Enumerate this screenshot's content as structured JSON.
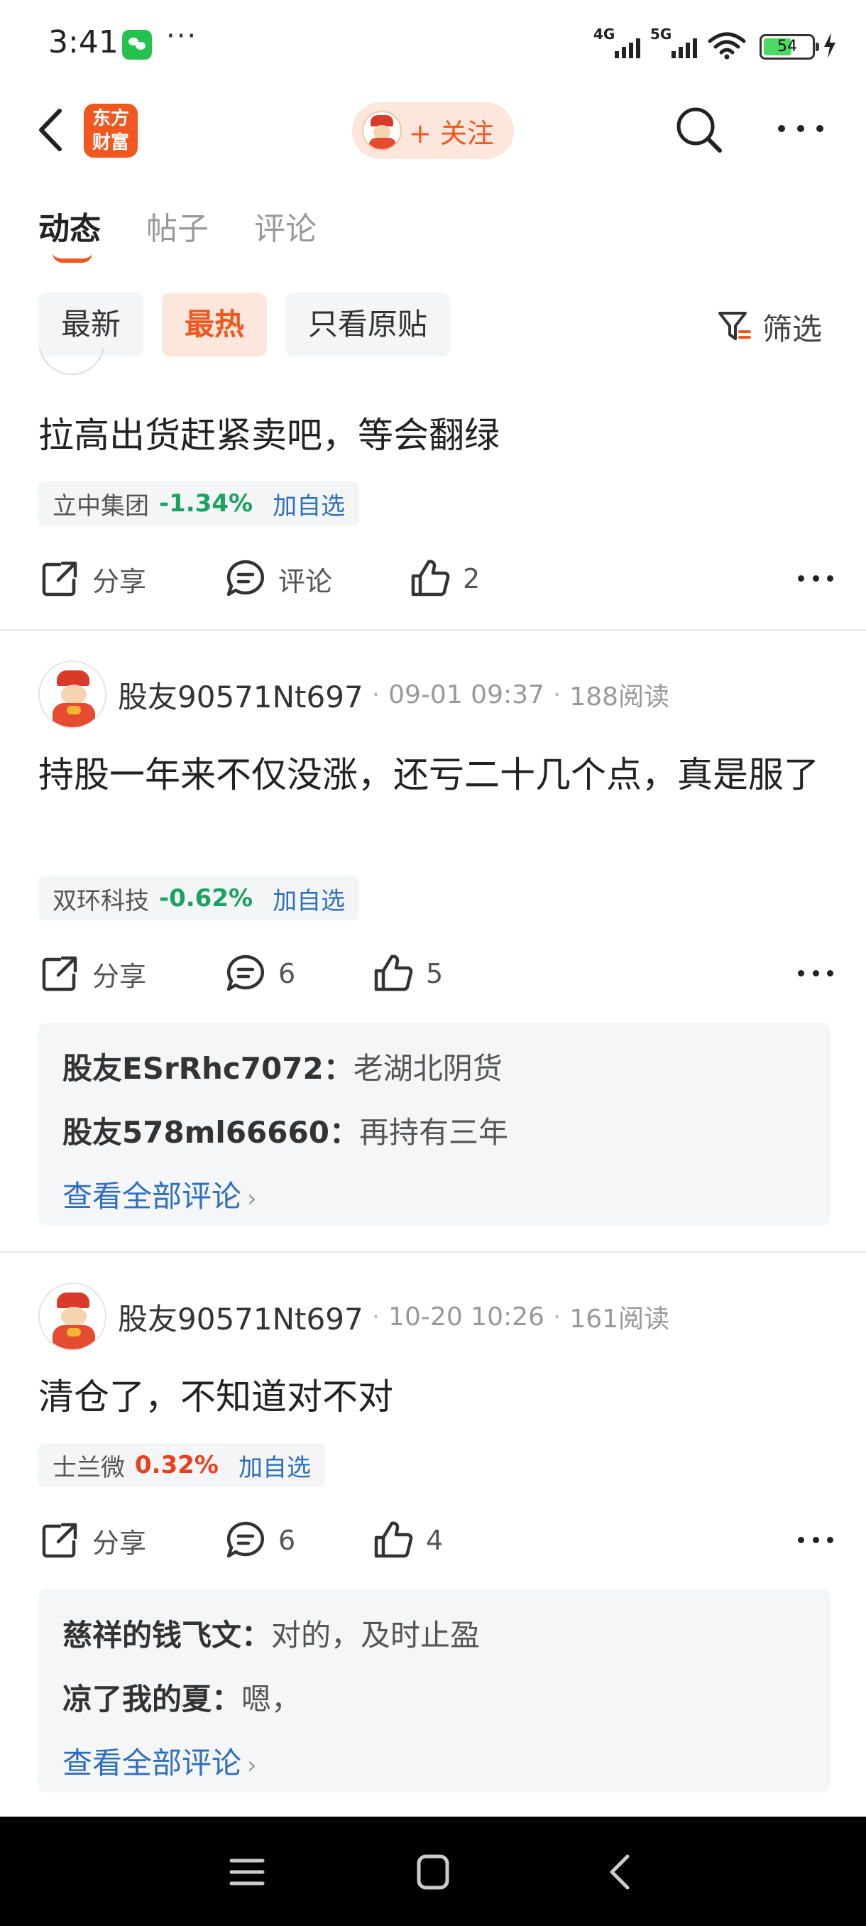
{
  "status_bar": {
    "time": "3:41",
    "more": "···",
    "signal_1": "4G",
    "signal_2": "5G",
    "battery": "54"
  },
  "header": {
    "logo_text_line1": "东方",
    "logo_text_line2": "财富",
    "follow_label": "+ 关注"
  },
  "tabs": [
    {
      "label": "动态",
      "active": true
    },
    {
      "label": "帖子",
      "active": false
    },
    {
      "label": "评论",
      "active": false
    }
  ],
  "filters": {
    "chips": [
      {
        "label": "最新",
        "active": false
      },
      {
        "label": "最热",
        "active": true
      },
      {
        "label": "只看原贴",
        "active": false
      }
    ],
    "filter_label": "筛选"
  },
  "posts": [
    {
      "text": "拉高出货赶紧卖吧，等会翻绿",
      "stock": {
        "name": "立中集团",
        "change": "-1.34%",
        "direction": "down",
        "add_label": "加自选"
      },
      "actions": {
        "share": "分享",
        "comment": "评论",
        "likes": "2"
      }
    },
    {
      "user": "股友90571Nt697",
      "date": "09-01 09:37",
      "reads": "188阅读",
      "text": "持股一年来不仅没涨，还亏二十几个点，真是服了",
      "stock": {
        "name": "双环科技",
        "change": "-0.62%",
        "direction": "down",
        "add_label": "加自选"
      },
      "actions": {
        "share": "分享",
        "comment": "6",
        "likes": "5"
      },
      "comments": [
        {
          "who": "股友ESrRhc7072",
          "sep": "：",
          "text": "老湖北阴货"
        },
        {
          "who": "股友578ml66660",
          "sep": "：",
          "text": "再持有三年"
        }
      ],
      "view_all": "查看全部评论"
    },
    {
      "user": "股友90571Nt697",
      "date": "10-20 10:26",
      "reads": "161阅读",
      "text": "清仓了，不知道对不对",
      "stock": {
        "name": "士兰微",
        "change": "0.32%",
        "direction": "up",
        "add_label": "加自选"
      },
      "actions": {
        "share": "分享",
        "comment": "6",
        "likes": "4"
      },
      "comments": [
        {
          "who": "慈祥的钱飞文",
          "sep": "：",
          "text": "对的，及时止盈"
        },
        {
          "who": "凉了我的夏",
          "sep": "：",
          "text": "嗯，"
        }
      ],
      "view_all": "查看全部评论"
    }
  ],
  "colors": {
    "accent": "#f0581f",
    "down": "#1aa260",
    "up": "#e8401c",
    "link": "#2f6fbf"
  },
  "icons": [
    "back-icon",
    "search-icon",
    "more-icon",
    "filter-icon",
    "share-icon",
    "comment-icon",
    "like-icon",
    "menu-icon",
    "home-icon",
    "nav-back-icon"
  ]
}
